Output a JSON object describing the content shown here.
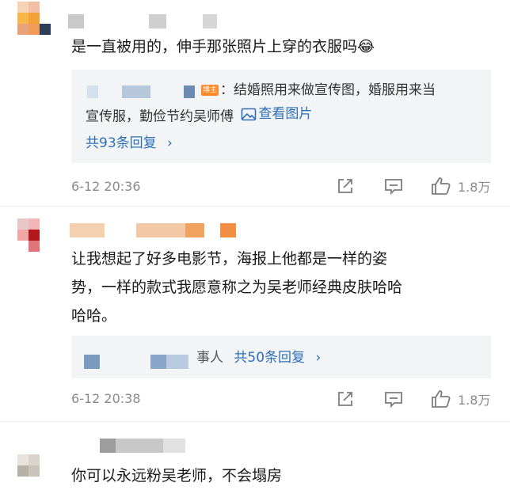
{
  "comments": [
    {
      "text": "是一直被用的，伸手那张照片上穿的衣服吗😂",
      "reply": {
        "badge": "博主",
        "line1": "：结婚照用来做宣传图，婚服用来当",
        "line2": "宣传服，勤俭节约吴师傅",
        "view_image": "查看图片",
        "count": "共93条回复",
        "chevron": "›"
      },
      "time": "6-12 20:36",
      "likes": "1.8万"
    },
    {
      "text_line1": "让我想起了好多电影节，海报上他都是一样的姿",
      "text_line2": "势，一样的款式我愿意称之为吴老师经典皮肤哈哈",
      "text_line3": "哈哈。",
      "reply": {
        "partial_name": "事人",
        "count": "共50条回复",
        "chevron": "›"
      },
      "time": "6-12 20:38",
      "likes": "1.8万"
    },
    {
      "text": "你可以永远粉吴老师，不会塌房"
    }
  ],
  "colors": {
    "link": "#2e6fb8",
    "meta": "#8a8a8a",
    "reply_bg": "#f3f4f6",
    "badge": "#ff8a2a"
  },
  "icons": [
    "picture-icon",
    "share-icon",
    "comment-icon",
    "like-icon"
  ]
}
